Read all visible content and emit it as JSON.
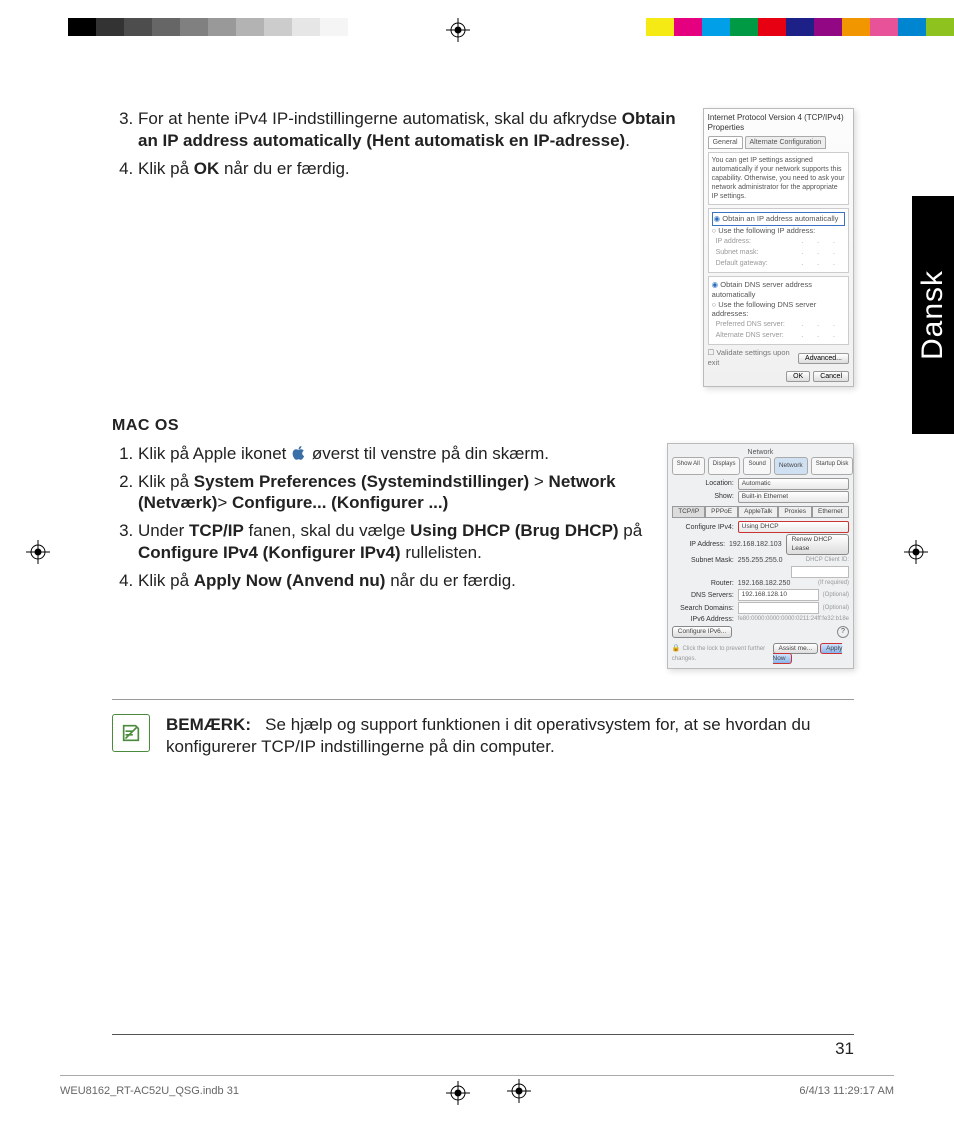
{
  "colorbar_left": [
    "#000000",
    "#333333",
    "#4d4d4d",
    "#666666",
    "#808080",
    "#999999",
    "#b3b3b3",
    "#cccccc",
    "#e6e6e6",
    "#f5f5f5",
    "#ffffff"
  ],
  "colorbar_right": [
    "#f5ea14",
    "#e4007f",
    "#009fe8",
    "#009944",
    "#e60012",
    "#1d2087",
    "#920783",
    "#f29600",
    "#e85298",
    "#0086d1",
    "#8dc21f"
  ],
  "lang_tab": "Dansk",
  "page_number": "31",
  "print_footer_left": "WEU8162_RT-AC52U_QSG.indb   31",
  "print_footer_right": "6/4/13   11:29:17 AM",
  "section1": {
    "step3_a": "For at hente iPv4 IP-indstillingerne automatisk, skal du afkrydse ",
    "step3_b": "Obtain an IP address automatically (Hent automatisk en IP-adresse)",
    "step3_c": ".",
    "step4_a": "Klik på ",
    "step4_b": "OK",
    "step4_c": " når du er færdig."
  },
  "win_dialog": {
    "title": "Internet Protocol Version 4 (TCP/IPv4) Properties",
    "tab_general": "General",
    "tab_alt": "Alternate Configuration",
    "msg": "You can get IP settings assigned automatically if your network supports this capability. Otherwise, you need to ask your network administrator for the appropriate IP settings.",
    "r1": "Obtain an IP address automatically",
    "r2": "Use the following IP address:",
    "f1": "IP address:",
    "f2": "Subnet mask:",
    "f3": "Default gateway:",
    "r3": "Obtain DNS server address automatically",
    "r4": "Use the following DNS server addresses:",
    "f4": "Preferred DNS server:",
    "f5": "Alternate DNS server:",
    "chk": "Validate settings upon exit",
    "adv": "Advanced...",
    "ok": "OK",
    "cancel": "Cancel"
  },
  "mac_heading": "MAC OS",
  "mac_steps": {
    "s1a": "Klik på Apple ikonet ",
    "s1b": " øverst til venstre på din skærm.",
    "s2a": "Klik på ",
    "s2b": "System Preferences (Systemindstillinger)",
    "s2c": " > ",
    "s2d": "Network (Netværk)",
    "s2e": "> ",
    "s2f": "Configure... (Konfigurer ...)",
    "s3a": "Under ",
    "s3b": "TCP/IP",
    "s3c": " fanen, skal du vælge ",
    "s3d": "Using DHCP (Brug DHCP)",
    "s3e": " på ",
    "s3f": "Configure IPv4 (Konfigurer IPv4)",
    "s3g": " rullelisten.",
    "s4a": "Klik på ",
    "s4b": "Apply Now (Anvend nu)",
    "s4c": " når du er færdig."
  },
  "mac_dialog": {
    "title": "Network",
    "tb": [
      "Show All",
      "Displays",
      "Sound",
      "Network",
      "Startup Disk"
    ],
    "loc_lbl": "Location:",
    "loc_val": "Automatic",
    "show_lbl": "Show:",
    "show_val": "Built-in Ethernet",
    "tabs": [
      "TCP/IP",
      "PPPoE",
      "AppleTalk",
      "Proxies",
      "Ethernet"
    ],
    "cfg_lbl": "Configure IPv4:",
    "cfg_val": "Using DHCP",
    "ip_lbl": "IP Address:",
    "ip_val": "192.168.182.103",
    "renew": "Renew DHCP Lease",
    "sm_lbl": "Subnet Mask:",
    "sm_val": "255.255.255.0",
    "cid_lbl": "DHCP Client ID:",
    "cid_hint": "(If required)",
    "rt_lbl": "Router:",
    "rt_val": "192.168.182.250",
    "dns_lbl": "DNS Servers:",
    "dns_val": "192.168.128.10",
    "opt": "(Optional)",
    "sd_lbl": "Search Domains:",
    "v6_lbl": "IPv6 Address:",
    "v6_val": "fe80:0000:0000:0000:0211:24ff:fe32:b18e",
    "cfg6": "Configure IPv6...",
    "lock": "Click the lock to prevent further changes.",
    "assist": "Assist me...",
    "apply": "Apply Now"
  },
  "note": {
    "label": "BEMÆRK:",
    "text": "Se hjælp og support funktionen i dit operativsystem for, at se hvordan du konfigurerer TCP/IP indstillingerne på din computer."
  }
}
